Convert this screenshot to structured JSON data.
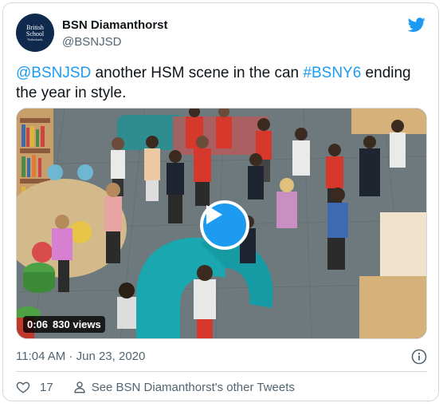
{
  "account": {
    "name": "BSN Diamanthorst",
    "handle": "@BSNJSD",
    "avatar_text_line1": "British",
    "avatar_text_line2": "School",
    "avatar_text_line3": "Netherlands"
  },
  "tweet": {
    "mention": "@BSNJSD",
    "text_part1": " another HSM scene in the can ",
    "hashtag": "#BSNY6",
    "text_part2": " ending the year in style."
  },
  "video": {
    "duration": "0:06",
    "views": "830 views"
  },
  "meta": {
    "time": "11:04 AM",
    "separator": " · ",
    "date": "Jun 23, 2020"
  },
  "actions": {
    "likes": "17",
    "other_tweets": "See BSN Diamanthorst's other Tweets"
  },
  "colors": {
    "accent": "#1d9bf0",
    "muted": "#536471",
    "border": "#cfd9de"
  },
  "icons": {
    "brand": "twitter-bird-icon",
    "info": "info-icon",
    "like": "heart-icon",
    "profile": "person-icon",
    "play": "play-icon"
  }
}
